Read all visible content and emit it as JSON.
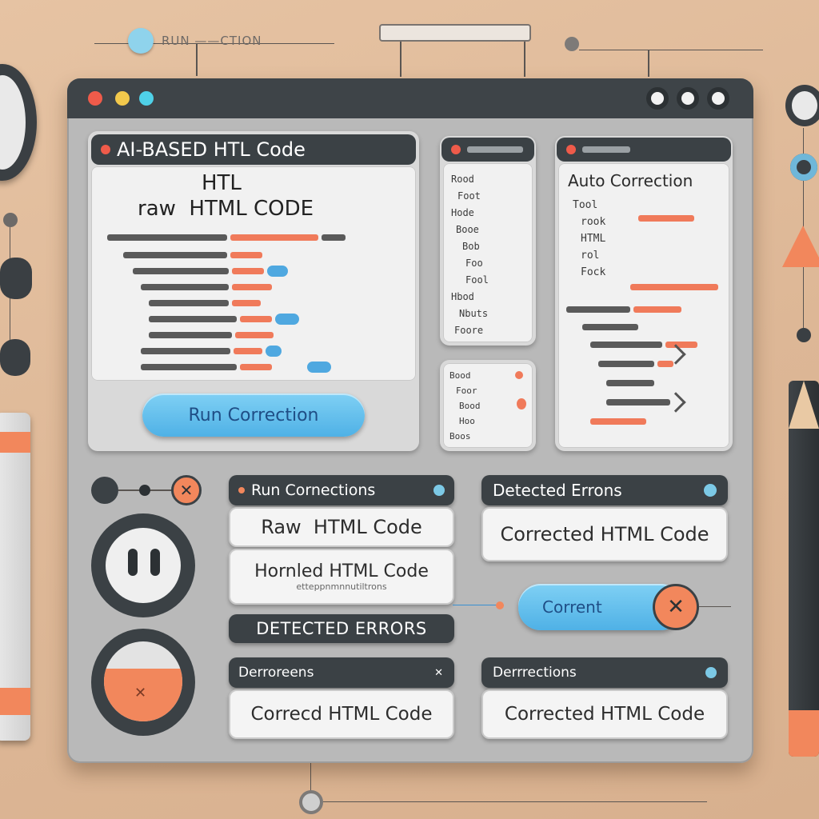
{
  "top_strip": {
    "label": "RUN ——CTION"
  },
  "window": {
    "title_dots": [
      "#ef5b4a",
      "#f2c94c",
      "#4fd1e8"
    ]
  },
  "editor_panel": {
    "header": "AI-BASED HTL Code",
    "heading_line1": "HTL",
    "heading_line2": "raw  HTML CODE",
    "run_button": "Run Correction"
  },
  "middle_panel": {
    "header": "",
    "lines": [
      "Rood",
      "Foot",
      "Hode",
      "Booe",
      "Bob",
      "Foo",
      "Fool",
      "Hbod",
      "Nbuts",
      "Foore"
    ]
  },
  "small_panel": {
    "lines": [
      "Bood",
      "Foor",
      "Bood",
      "Hoo",
      "Boos"
    ]
  },
  "auto_panel": {
    "header": "",
    "title": "Auto Correction",
    "lines": [
      "Tool",
      "rook",
      "HTML",
      "rol",
      "Fock"
    ]
  },
  "controls": {
    "run_corrections": "Run Cornections",
    "raw_html": "Raw  HTML Code",
    "hornled_html": "Hornled HTML Code",
    "hornled_sub": "etteppnmnnutiltrons",
    "detected_errors_caps": "DETECTED ERRORS",
    "derrorens": "Derroreens",
    "corrected_left": "Correcd HTML Code",
    "detected_errors": "Detected Errons",
    "corrected_right": "Corrected HTML Code",
    "correct_button": "Corrent",
    "derrections": "Derrrections",
    "corrected_bottom_right": "Corrected HTML Code"
  },
  "colors": {
    "accent_blue": "#5bbcec",
    "accent_orange": "#f0855a",
    "dark": "#3b4145"
  }
}
